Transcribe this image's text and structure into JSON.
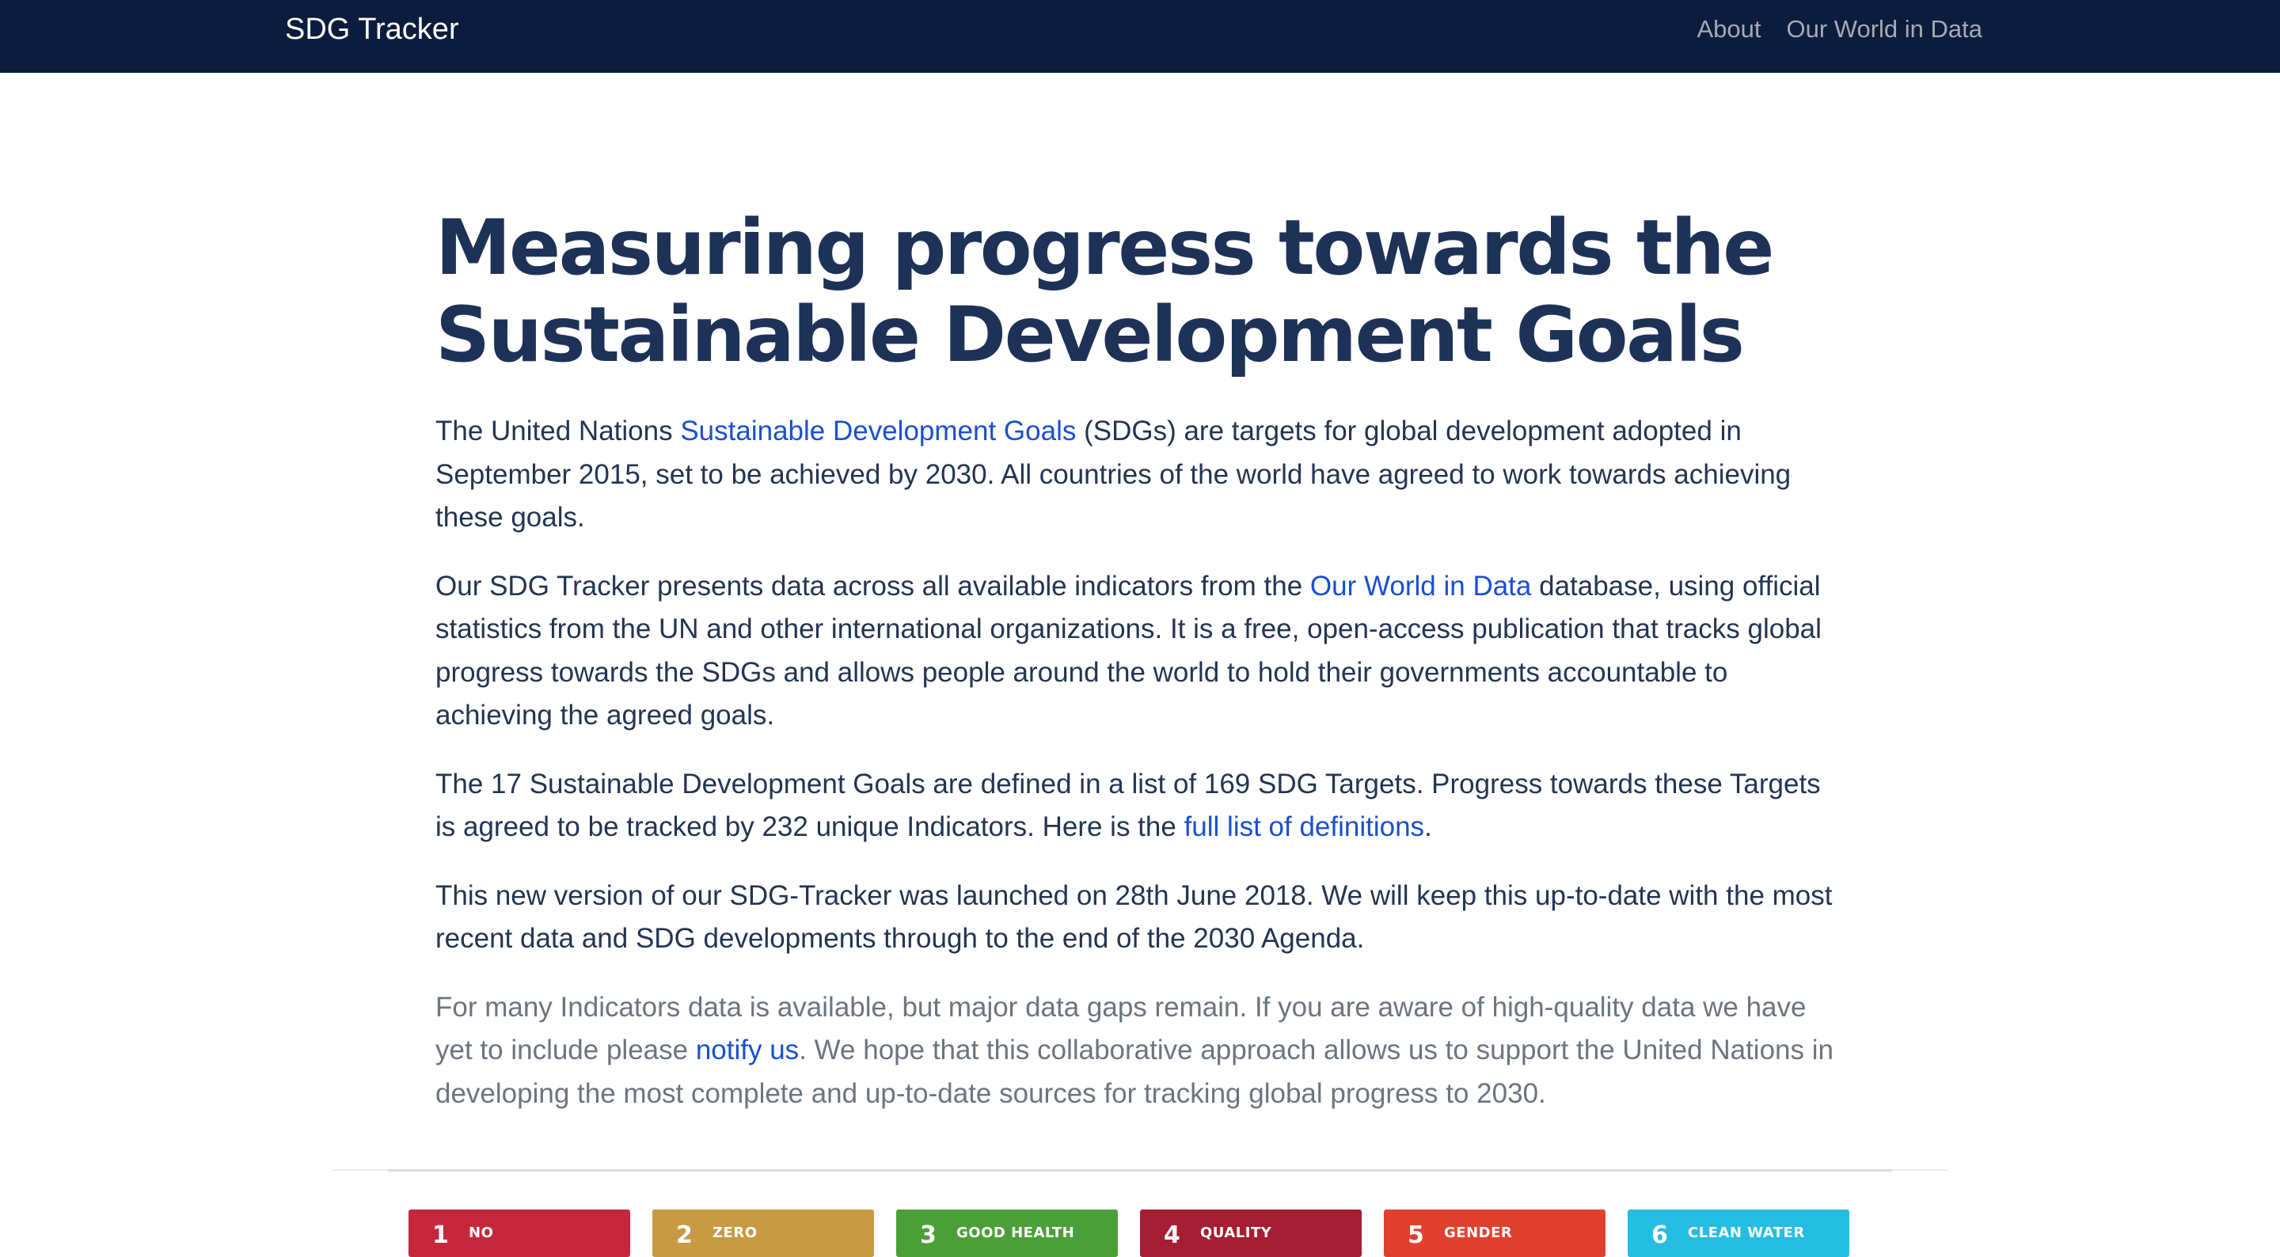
{
  "navbar": {
    "brand": "SDG Tracker",
    "links": [
      {
        "label": "About"
      },
      {
        "label": "Our World in Data"
      }
    ]
  },
  "main": {
    "title": "Measuring progress towards the Sustainable Development Goals",
    "para1": {
      "before": "The United Nations ",
      "link": "Sustainable Development Goals",
      "after": " (SDGs) are targets for global development adopted in September 2015, set to be achieved by 2030. All countries of the world have agreed to work towards achieving these goals."
    },
    "para2": {
      "before": "Our SDG Tracker presents data across all available indicators from the ",
      "link": "Our World in Data",
      "after": " database, using official statistics from the UN and other international organizations. It is a free, open-access publication that tracks global progress towards the SDGs and allows people around the world to hold their governments accountable to achieving the agreed goals."
    },
    "para3": {
      "before": "The 17 Sustainable Development Goals are defined in a list of 169 SDG Targets. Progress towards these Targets is agreed to be tracked by 232 unique Indicators. Here is the ",
      "link": "full list of definitions",
      "after": "."
    },
    "para4": "This new version of our SDG-Tracker was launched on 28th June 2018. We will keep this up-to-date with the most recent data and SDG developments through to the end of the 2030 Agenda.",
    "para5": {
      "before": "For many Indicators data is available, but major data gaps remain. If you are aware of high-quality data we have yet to include please ",
      "link": "notify us",
      "after": ". We hope that this collaborative approach allows us to support the United Nations in developing the most complete and up-to-date sources for tracking global progress to 2030."
    }
  },
  "goal_tiles": [
    {
      "number": "1",
      "label": "NO",
      "color": "#c5283d"
    },
    {
      "number": "2",
      "label": "ZERO",
      "color": "#c89a44"
    },
    {
      "number": "3",
      "label": "GOOD HEALTH",
      "color": "#4c9f38"
    },
    {
      "number": "4",
      "label": "QUALITY",
      "color": "#a51e33"
    },
    {
      "number": "5",
      "label": "GENDER",
      "color": "#e1402f"
    },
    {
      "number": "6",
      "label": "CLEAN WATER",
      "color": "#26bde2"
    }
  ]
}
